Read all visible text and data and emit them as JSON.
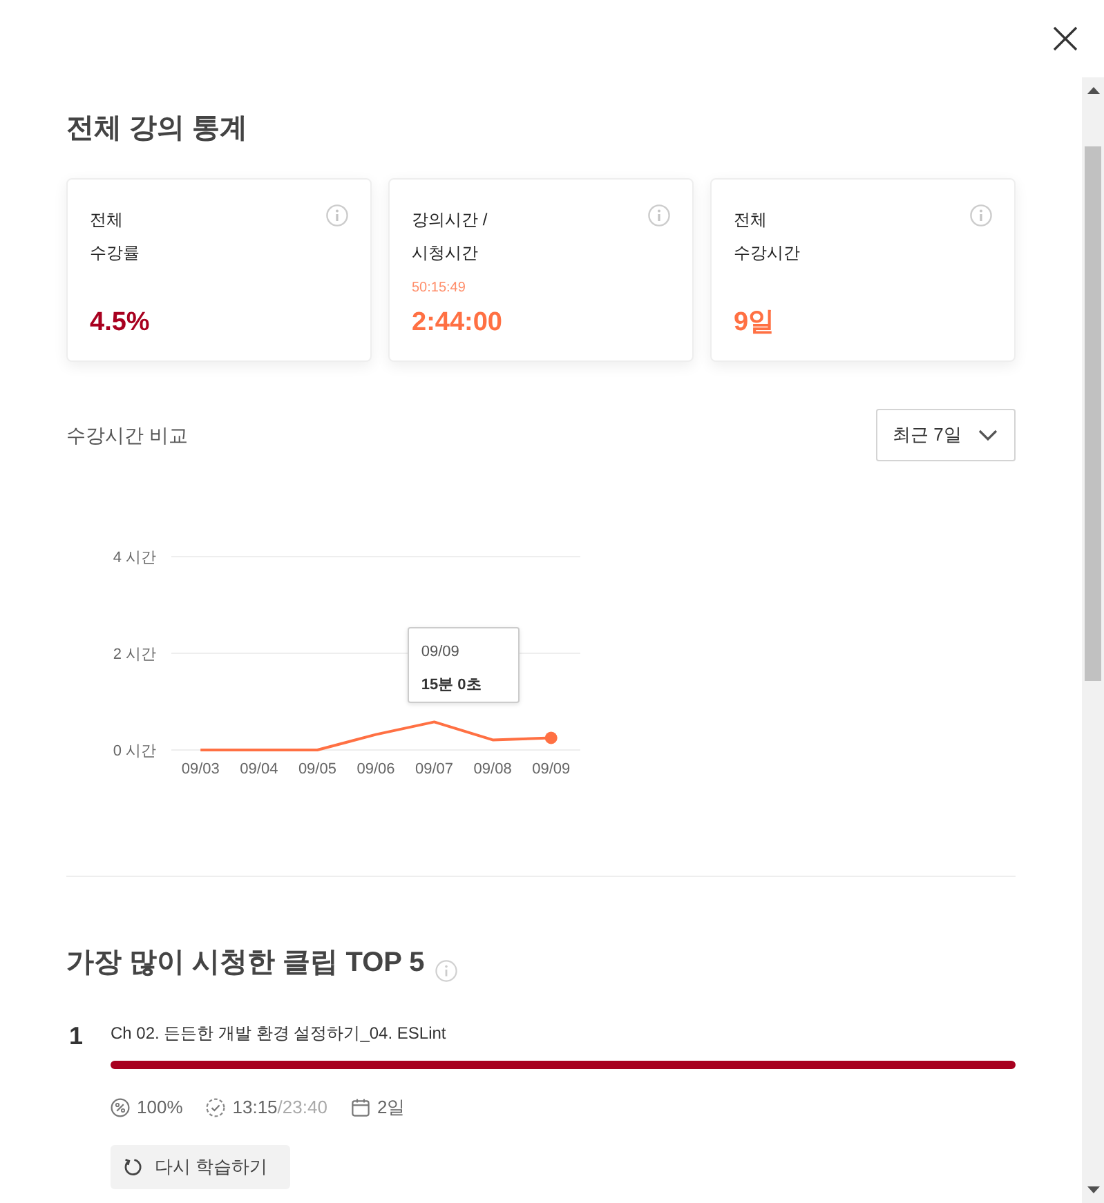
{
  "overall_stats": {
    "title": "전체 강의 통계",
    "cards": [
      {
        "label": "전체\n수강률",
        "value": "4.5%",
        "color": "#a8001f"
      },
      {
        "label": "강의시간 /\n시청시간",
        "sub_value": "50:15:49",
        "value": "2:44:00",
        "color": "#ff7043"
      },
      {
        "label": "전체\n수강시간",
        "value": "9일",
        "color": "#ff7043"
      }
    ]
  },
  "watch_time_comparison": {
    "title": "수강시간 비교",
    "period_select": {
      "value": "최근 7일"
    },
    "chart_data": {
      "type": "line",
      "categories": [
        "09/03",
        "09/04",
        "09/05",
        "09/06",
        "09/07",
        "09/08",
        "09/09"
      ],
      "series": [
        {
          "color": "#ff7043",
          "values": [
            0,
            0,
            0,
            0.32,
            0.58,
            0.21,
            0.25
          ]
        }
      ],
      "ylim": [
        0,
        4
      ],
      "yticks": [
        {
          "value": 0,
          "label": "0 시간"
        },
        {
          "value": 2,
          "label": "2 시간"
        },
        {
          "value": 4,
          "label": "4 시간"
        }
      ]
    },
    "tooltip": {
      "title": "09/09",
      "value": "15분 0초"
    }
  },
  "top_clips": {
    "title": "가장 많이 시청한 클립 TOP 5",
    "items": [
      {
        "rank": "1",
        "title": "Ch 02. 든든한 개발 환경 설정하기_04. ESLint",
        "level": 1,
        "completion": "100%",
        "watched": "13:15",
        "duration": "/23:40",
        "days": "2일",
        "action": "다시 학습하기"
      }
    ]
  }
}
